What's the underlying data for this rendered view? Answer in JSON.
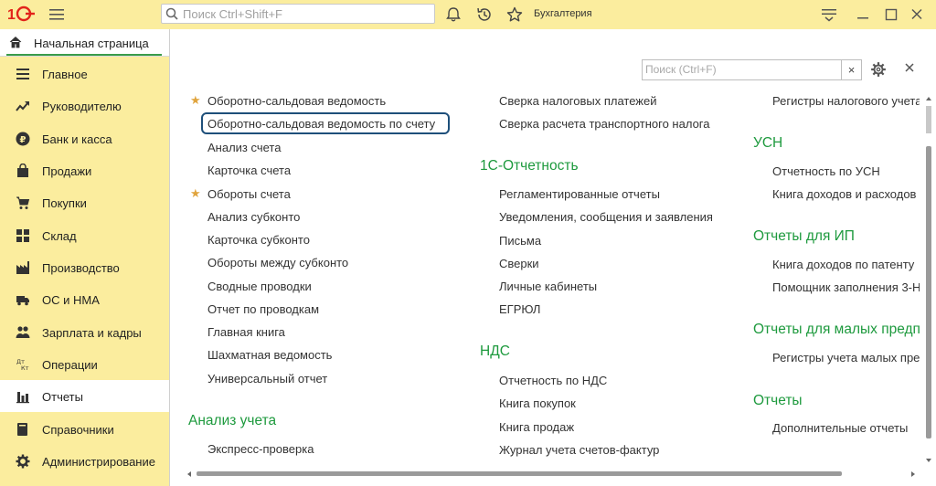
{
  "header": {
    "search_placeholder": "Поиск Ctrl+Shift+F",
    "app_title": "Бухгалтерия"
  },
  "home_tab": {
    "label": "Начальная страница"
  },
  "sidebar": {
    "items": [
      {
        "label": "Главное",
        "icon": "lines-icon"
      },
      {
        "label": "Руководителю",
        "icon": "trend-icon"
      },
      {
        "label": "Банк и касса",
        "icon": "ruble-coin-icon"
      },
      {
        "label": "Продажи",
        "icon": "shopping-bag-icon"
      },
      {
        "label": "Покупки",
        "icon": "cart-icon"
      },
      {
        "label": "Склад",
        "icon": "warehouse-grid-icon"
      },
      {
        "label": "Производство",
        "icon": "factory-icon"
      },
      {
        "label": "ОС и НМА",
        "icon": "truck-icon"
      },
      {
        "label": "Зарплата и кадры",
        "icon": "people-icon"
      },
      {
        "label": "Операции",
        "icon": "dt-kt-icon"
      },
      {
        "label": "Отчеты",
        "icon": "bar-chart-icon",
        "active": true
      },
      {
        "label": "Справочники",
        "icon": "book-icon"
      },
      {
        "label": "Администрирование",
        "icon": "gear-icon"
      }
    ],
    "dt_text": "Дт",
    "kt_text": "Кт"
  },
  "main": {
    "search_placeholder": "Поиск (Ctrl+F)",
    "clear_label": "×",
    "col1": {
      "links": [
        "Оборотно-сальдовая ведомость",
        "Оборотно-сальдовая ведомость по счету",
        "Анализ счета",
        "Карточка счета",
        "Обороты счета",
        "Анализ субконто",
        "Карточка субконто",
        "Обороты между субконто",
        "Сводные проводки",
        "Отчет по проводкам",
        "Главная книга",
        "Шахматная ведомость",
        "Универсальный отчет"
      ],
      "group2": "Анализ учета",
      "group2_links": [
        "Экспресс-проверка"
      ]
    },
    "col2": {
      "top_links": [
        "Сверка налоговых платежей",
        "Сверка расчета транспортного налога"
      ],
      "group1": "1С-Отчетность",
      "group1_links": [
        "Регламентированные отчеты",
        "Уведомления, сообщения и заявления",
        "Письма",
        "Сверки",
        "Личные кабинеты",
        "ЕГРЮЛ"
      ],
      "group2": "НДС",
      "group2_links": [
        "Отчетность по НДС",
        "Книга покупок",
        "Книга продаж",
        "Журнал учета счетов-фактур"
      ]
    },
    "col3": {
      "top_links": [
        "Регистры налогового учета"
      ],
      "group1": "УСН",
      "group1_links": [
        "Отчетность по УСН",
        "Книга доходов и расходов"
      ],
      "group2": "Отчеты для ИП",
      "group2_links": [
        "Книга доходов по патенту",
        "Помощник заполнения 3-Н"
      ],
      "group3": "Отчеты для малых предприятий",
      "group3_links": [
        "Регистры учета малых предприятий"
      ],
      "group4": "Отчеты",
      "group4_links": [
        "Дополнительные отчеты"
      ]
    }
  },
  "colors": {
    "sidebar_bg": "#fbed9e",
    "group_heading": "#1e9a3e",
    "focus_border": "#1e4f7a",
    "star": "#e0a43d"
  }
}
